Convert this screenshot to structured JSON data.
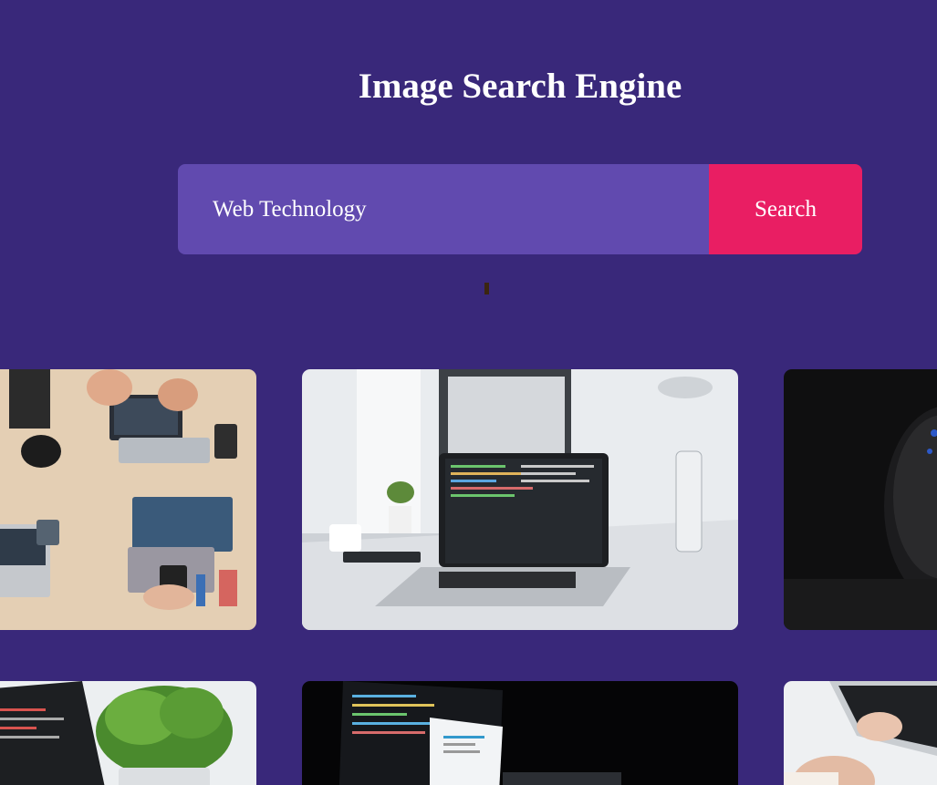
{
  "header": {
    "title": "Image Search Engine"
  },
  "search": {
    "value": "Web Technology",
    "button_label": "Search"
  },
  "results": {
    "images": [
      "team-desk-laptops-photo",
      "laptop-code-desk-photo",
      "dark-sphere-tech-photo",
      "laptop-code-plant-photo",
      "monitor-code-dark-photo",
      "hands-typing-keyboard-photo"
    ]
  },
  "colors": {
    "background": "#39287a",
    "input_bg": "#614aaf",
    "button_bg": "#e91e63",
    "text": "#ffffff"
  }
}
